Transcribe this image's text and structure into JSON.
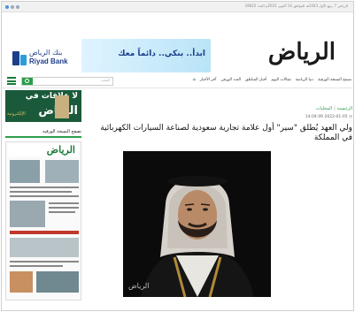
{
  "browser": {
    "status_text": "الرياض 7 ربيع الأول 1443هـ الموافق 14 أكتوبر 2021م العدد 19022"
  },
  "header": {
    "bank_name_ar": "بنك الرياض",
    "bank_name_en": "Riyad Bank",
    "ad_headline": "ابدأ.. بنكي.. دائماً معك",
    "ad_sub": "",
    "site_logo": "الرياض"
  },
  "nav": {
    "search_placeholder": "البحث",
    "items": [
      "الرئيسية",
      "آخر الأخبار",
      "العدد الورقي",
      "أخبار المناطق",
      "مقالات اليوم",
      "دنيا الرياضة",
      "تصفح النسخة الورقية"
    ]
  },
  "sidebar": {
    "ad_line1": "لا علاقات في",
    "ad_line2": "الرياض",
    "ad_line3": "الإلكترونية",
    "section_title": "تصفح النسخة الورقية",
    "newspaper_mast": "الرياض"
  },
  "article": {
    "breadcrumb_home": "الرئيسية",
    "breadcrumb_section": "المحليات",
    "date": "2022-01-05 14:04:09",
    "headline": "ولي العهد يُطلق \"سير\" أول علامة تجارية سعودية لصناعة السيارات الكهربائية في المملكة",
    "photo_watermark": "الرياض"
  },
  "colors": {
    "accent": "#2a9d4a",
    "brand_dark": "#1a7a3a",
    "bank_blue": "#1d3f8a"
  }
}
